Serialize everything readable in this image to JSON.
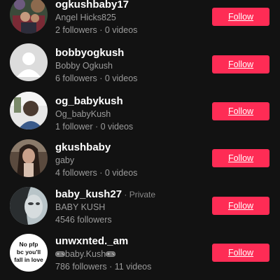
{
  "users": [
    {
      "username": "ogkushbaby17",
      "nickname": "Angel Hicks825",
      "stats": "2 followers · 0 videos",
      "follow_label": "Follow"
    },
    {
      "username": "bobbyogkush",
      "nickname": "Bobby Ogkush",
      "stats": "6 followers · 0 videos",
      "follow_label": "Follow"
    },
    {
      "username": "og_babykush",
      "nickname": "Og_babyKush",
      "stats": "1 follower · 0 videos",
      "follow_label": "Follow"
    },
    {
      "username": "gkushbaby",
      "nickname": "gaby",
      "stats": "4 followers · 0 videos",
      "follow_label": "Follow"
    },
    {
      "username": "baby_kush27",
      "private_label": " · Private",
      "nickname": "BABY KUSH",
      "stats": "4546 followers",
      "follow_label": "Follow"
    },
    {
      "username": "unwxnted._am",
      "nickname": "baby.Kush",
      "stats": "786 followers · 11 videos",
      "follow_label": "Follow",
      "avatar_text": [
        "No pfp",
        "bc you'll",
        "fall in love"
      ]
    }
  ],
  "colors": {
    "background": "#121212",
    "follow_button": "#fe2c55",
    "primary_text": "#ffffff",
    "secondary_text": "#9b9b9b"
  },
  "icons": {
    "default_avatar": "person-silhouette-icon",
    "nickname_decoration": "game-controller-icon"
  }
}
